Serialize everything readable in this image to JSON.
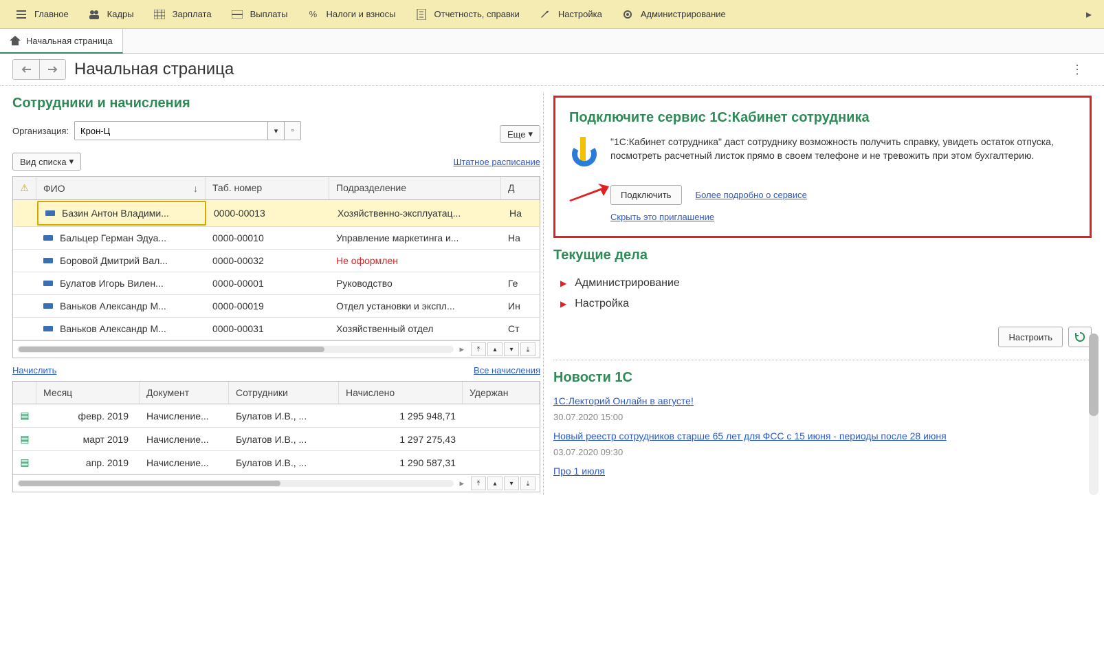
{
  "topbar": {
    "items": [
      {
        "label": "Главное"
      },
      {
        "label": "Кадры"
      },
      {
        "label": "Зарплата"
      },
      {
        "label": "Выплаты"
      },
      {
        "label": "Налоги и взносы"
      },
      {
        "label": "Отчетность, справки"
      },
      {
        "label": "Настройка"
      },
      {
        "label": "Администрирование"
      }
    ]
  },
  "tab": {
    "home_label": "Начальная страница"
  },
  "page": {
    "title": "Начальная страница"
  },
  "employees": {
    "title": "Сотрудники и начисления",
    "org_label": "Организация:",
    "org_value": "Крон-Ц",
    "more_label": "Еще",
    "view_label": "Вид списка",
    "staff_link": "Штатное расписание",
    "columns": {
      "fio": "ФИО",
      "tab": "Таб. номер",
      "dept": "Подразделение",
      "extra": "Д"
    },
    "rows": [
      {
        "fio": "Базин Антон Владими...",
        "tab": "0000-00013",
        "dept": "Хозяйственно-эксплуатац...",
        "extra": "На",
        "selected": true
      },
      {
        "fio": "Бальцер Герман Эдуа...",
        "tab": "0000-00010",
        "dept": "Управление маркетинга и...",
        "extra": "На"
      },
      {
        "fio": "Боровой Дмитрий Вал...",
        "tab": "0000-00032",
        "dept": "Не оформлен",
        "extra": "",
        "red": true
      },
      {
        "fio": "Булатов Игорь Вилен...",
        "tab": "0000-00001",
        "dept": "Руководство",
        "extra": "Ге"
      },
      {
        "fio": "Ваньков Александр М...",
        "tab": "0000-00019",
        "dept": "Отдел установки и экспл...",
        "extra": "Ин"
      },
      {
        "fio": "Ваньков Александр М...",
        "tab": "0000-00031",
        "dept": "Хозяйственный отдел",
        "extra": "Ст"
      }
    ],
    "accrue_link": "Начислить",
    "all_accruals_link": "Все начисления"
  },
  "accruals": {
    "columns": {
      "month": "Месяц",
      "doc": "Документ",
      "emp": "Сотрудники",
      "acc": "Начислено",
      "hold": "Удержан"
    },
    "rows": [
      {
        "month": "февр. 2019",
        "doc": "Начисление...",
        "emp": "Булатов И.В., ...",
        "acc": "1 295 948,71"
      },
      {
        "month": "март 2019",
        "doc": "Начисление...",
        "emp": "Булатов И.В., ...",
        "acc": "1 297 275,43"
      },
      {
        "month": "апр. 2019",
        "doc": "Начисление...",
        "emp": "Булатов И.В., ...",
        "acc": "1 290 587,31"
      }
    ]
  },
  "invite": {
    "title": "Подключите сервис 1С:Кабинет сотрудника",
    "text": "\"1С:Кабинет сотрудника\" даст сотруднику возможность получить справку, увидеть остаток отпуска, посмотреть расчетный листок прямо в своем телефоне и не тревожить при этом бухгалтерию.",
    "connect_btn": "Подключить",
    "more_link": "Более подробно о сервисе",
    "hide_link": "Скрыть это приглашение"
  },
  "tasks": {
    "title": "Текущие дела",
    "items": [
      "Администрирование",
      "Настройка"
    ],
    "settings_btn": "Настроить"
  },
  "news": {
    "title": "Новости 1С",
    "items": [
      {
        "title": "1С:Лекторий Онлайн в августе!",
        "date": "30.07.2020 15:00"
      },
      {
        "title": "Новый реестр сотрудников старше 65 лет для ФСС с 15 июня - периоды после 28 июня",
        "date": "03.07.2020 09:30"
      },
      {
        "title": "Про 1 июля",
        "date": ""
      }
    ]
  }
}
